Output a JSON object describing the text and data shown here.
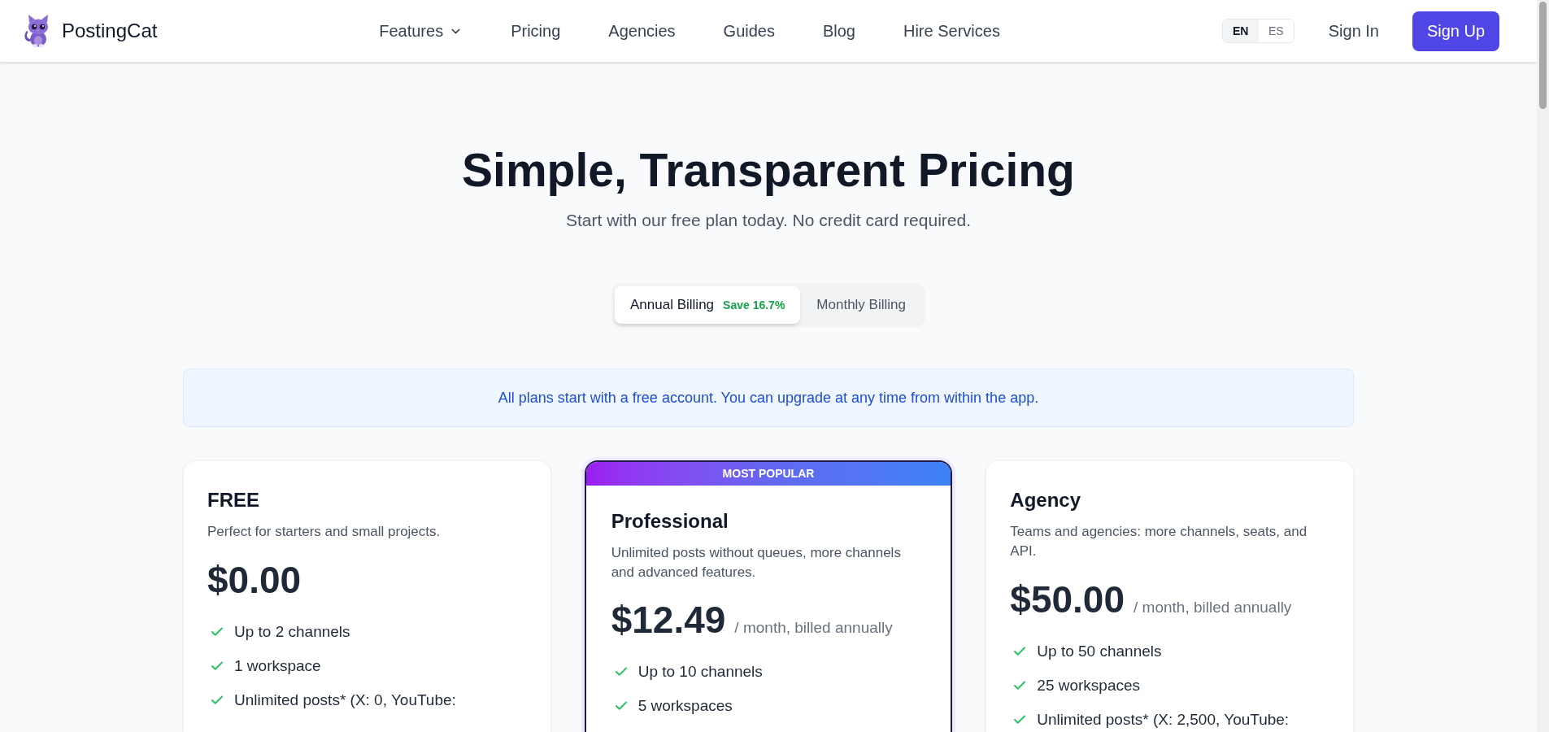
{
  "header": {
    "brand": "PostingCat",
    "nav": [
      {
        "label": "Features",
        "kind": "dropdown"
      },
      {
        "label": "Pricing",
        "kind": "link"
      },
      {
        "label": "Agencies",
        "kind": "link"
      },
      {
        "label": "Guides",
        "kind": "link"
      },
      {
        "label": "Blog",
        "kind": "link"
      },
      {
        "label": "Hire Services",
        "kind": "link"
      }
    ],
    "languages": [
      {
        "label": "EN",
        "selected": true
      },
      {
        "label": "ES",
        "selected": false
      }
    ],
    "sign_in": "Sign In",
    "sign_up": "Sign Up"
  },
  "hero": {
    "title": "Simple, Transparent Pricing",
    "subtitle": "Start with our free plan today. No credit card required."
  },
  "billing": [
    {
      "label": "Annual Billing",
      "discount": "Save 16.7%",
      "selected": true
    },
    {
      "label": "Monthly Billing",
      "selected": false
    }
  ],
  "notice": "All plans start with a free account. You can upgrade at any time from within the app.",
  "plans": [
    {
      "name": "FREE",
      "highlighted": false,
      "description": "Perfect for starters and small projects.",
      "price": "$0.00",
      "features": [
        "Up to 2 channels",
        "1 workspace",
        "Unlimited posts* (X: 0, YouTube:"
      ]
    },
    {
      "name": "Professional",
      "highlighted": true,
      "ribbon": "MOST POPULAR",
      "description": "Unlimited posts without queues, more channels and advanced features.",
      "price": "$12.49",
      "period": "/ month, billed annually",
      "features": [
        "Up to 10 channels",
        "5 workspaces"
      ]
    },
    {
      "name": "Agency",
      "highlighted": false,
      "description": "Teams and agencies: more channels, seats, and API.",
      "price": "$50.00",
      "period": "/ month, billed annually",
      "features": [
        "Up to 50 channels",
        "25 workspaces",
        "Unlimited posts* (X: 2,500, YouTube:"
      ]
    }
  ]
}
